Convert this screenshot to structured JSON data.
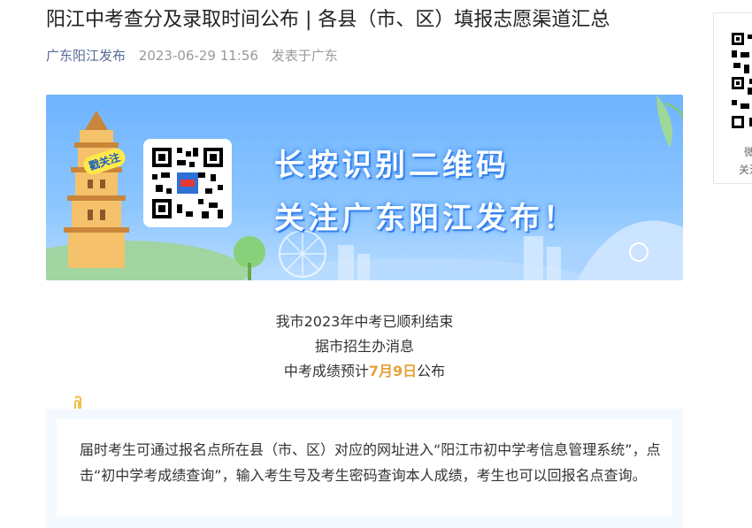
{
  "article": {
    "title": "阳江中考查分及录取时间公布 | 各县（市、区）填报志愿渠道汇总",
    "author": "广东阳江发布",
    "date": "2023-06-29 11:56",
    "location": "发表于广东"
  },
  "banner": {
    "line1": "长按识别二维码",
    "line2": "关注广东阳江发布！",
    "follow_tag": "戳关注",
    "bg_color": "#7dbcff"
  },
  "body": {
    "line1": "我市2023年中考已顺利结束",
    "line2": "据市招生办消息",
    "line3_prefix": "中考成绩预计",
    "line3_highlight": "7月9日",
    "line3_suffix": "公布",
    "highlight_color": "#e6a23c"
  },
  "notice": {
    "text": "届时考生可通过报名点所在县（市、区）对应的网址进入“阳江市初中学考信息管理系统”，点击“初中学考成绩查询”，输入考生号及考生密码查询本人成绩，考生也可以回报名点查询。"
  },
  "side_qr": {
    "label1": "微",
    "label2": "关注"
  },
  "icons": [
    "paperclip-icon",
    "qr-code-icon",
    "pagoda-illustration",
    "ferris-wheel-illustration"
  ]
}
